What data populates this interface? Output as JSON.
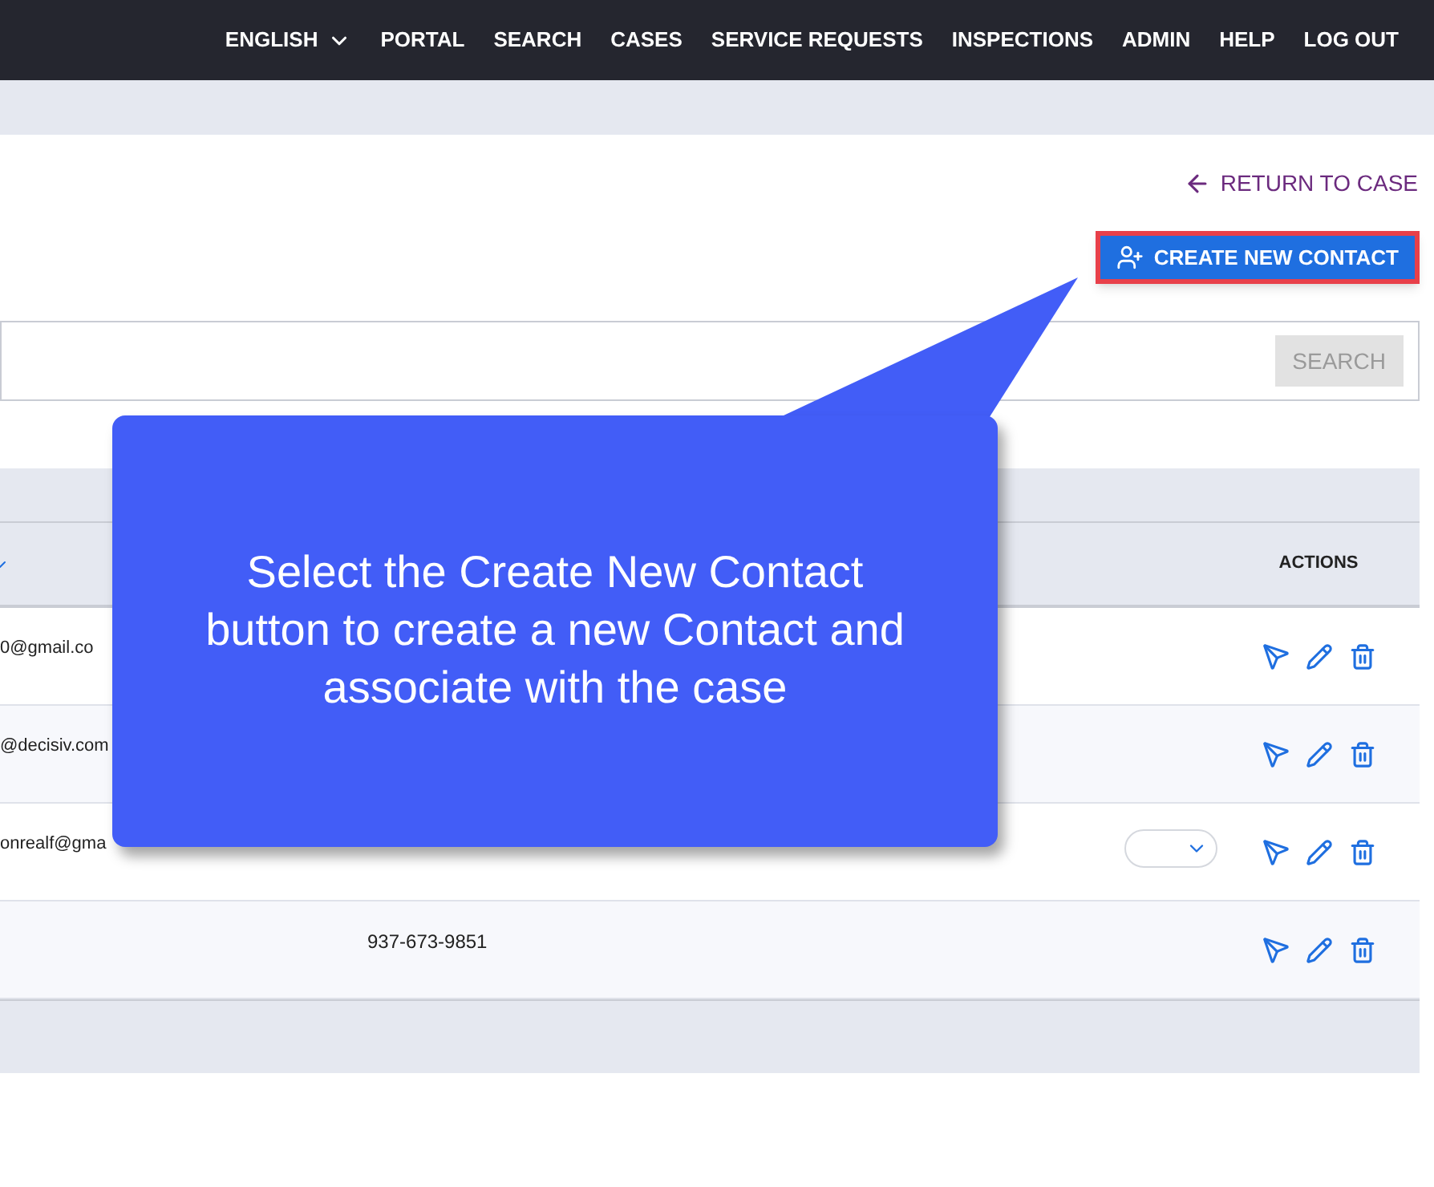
{
  "nav": {
    "language": "ENGLISH",
    "items": [
      "PORTAL",
      "SEARCH",
      "CASES",
      "SERVICE REQUESTS",
      "INSPECTIONS",
      "ADMIN",
      "HELP",
      "LOG OUT"
    ]
  },
  "return_link": "RETURN TO CASE",
  "create_button": {
    "label": "CREATE NEW CONTACT",
    "highlighted": true
  },
  "search": {
    "button": "SEARCH",
    "disabled": true
  },
  "table": {
    "columns": [
      {
        "label": "ACTIONS"
      }
    ],
    "rows": [
      {
        "email": "0@gmail.co",
        "phone": "",
        "dropdown": false
      },
      {
        "email": "@decisiv.com",
        "phone": "",
        "dropdown": false
      },
      {
        "email": "onrealf@gma",
        "phone": "",
        "dropdown": true
      },
      {
        "email": "",
        "phone": "937-673-9851",
        "dropdown": false
      }
    ]
  },
  "callout": {
    "text": "Select the Create New Contact button to create a new Contact and associate with the case"
  }
}
